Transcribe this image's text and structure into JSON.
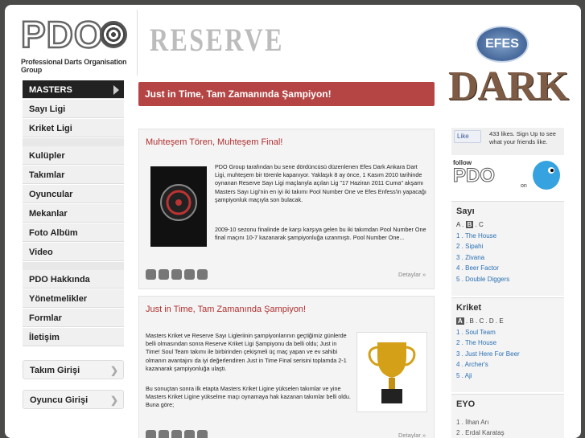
{
  "header": {
    "logo_text": "PDO",
    "logo_tagline": "Professional Darts Organisation Group",
    "section": "RESERVE",
    "sponsor_top": "EFES",
    "sponsor_main": "DARK"
  },
  "nav": {
    "group1": [
      {
        "label": "MASTERS"
      },
      {
        "label": "Sayı Ligi"
      },
      {
        "label": "Kriket Ligi"
      }
    ],
    "group2": [
      {
        "label": "Kulüpler"
      },
      {
        "label": "Takımlar"
      },
      {
        "label": "Oyuncular"
      },
      {
        "label": "Mekanlar"
      },
      {
        "label": "Foto Albüm"
      },
      {
        "label": "Video"
      }
    ],
    "group3": [
      {
        "label": "PDO Hakkında"
      },
      {
        "label": "Yönetmelikler"
      },
      {
        "label": "Formlar"
      },
      {
        "label": "İletişim"
      }
    ],
    "team_login": "Takım Girişi",
    "player_login": "Oyuncu Girişi"
  },
  "banner": {
    "title": "Just in Time, Tam Zamanında Şampiyon!"
  },
  "posts": [
    {
      "title": "Muhteşem Tören, Muhteşem Final!",
      "p1": "PDO Group tarafından bu sene dördüncüsü düzenlenen Efes Dark Ankara Dart Ligi, muhteşem bir törenle kapanıyor. Yaklaşık 8 ay önce, 1 Kasım 2010 tarihinde oynanan Reserve Sayı Ligi maçlarıyla açılan Lig \"17 Haziran 2011 Cuma\" akşamı Masters Sayı Ligi'nin en iyi iki takımı Pool Number One ve Efes Enfess'in yapacağı şampiyonluk maçıyla son bulacak.",
      "p2": "2009-10 sezonu finalinde de karşı karşıya gelen bu iki takımdan Pool Number One final maçını 10-7 kazanarak şampiyonluğa uzanmıştı. Pool Number One...",
      "more": "Detaylar »"
    },
    {
      "title": "Just in Time, Tam Zamanında Şampiyon!",
      "p1": "Masters Kriket ve Reserve Sayı Ligleriinin şampiyonlarının geçtiğimiz günlerde belli olmasından sonra Reserve Kriket Ligi Şampiyonu da belli oldu; Just in Time! Soul Team takımı ile birbirinden çekişmeli üç maç yapan ve ev sahibi olmanın avantajını da iyi değerlendiren Just in Time Final serisini toplamda 2-1 kazanarak şampiyonluğa ulaştı.",
      "p2": "Bu sonuçtan sonra ilk etapta Masters Kriket Ligine yükselen takımlar ve yine Masters Kriket Ligine yükselme maçı oynamaya hak kazanan takımlar belli oldu. Buna göre;",
      "more": "Detaylar »"
    }
  ],
  "facebook": {
    "like": "Like",
    "text": "433 likes. Sign Up to see what your friends like."
  },
  "follow": {
    "prefix": "follow",
    "brand": "PDO",
    "suffix": "on"
  },
  "sayi": {
    "title": "Sayı",
    "letters": [
      "A",
      "B",
      "C"
    ],
    "active_letter": "B",
    "items": [
      "1 . The House",
      "2 . Sipahi",
      "3 . Zivana",
      "4 . Beer Factor",
      "5 . Double Diggers"
    ]
  },
  "kriket": {
    "title": "Kriket",
    "letters": [
      "A",
      "B",
      "C",
      "D",
      "E"
    ],
    "active_letter": "A",
    "items": [
      "1 . Soul Team",
      "2 . The House",
      "3 . Just Here For Beer",
      "4 . Archer's",
      "5 . Aji"
    ]
  },
  "eyo": {
    "title": "EYO",
    "items": [
      "1 . İlhan Arı",
      "2 . Erdal Karataş"
    ]
  }
}
